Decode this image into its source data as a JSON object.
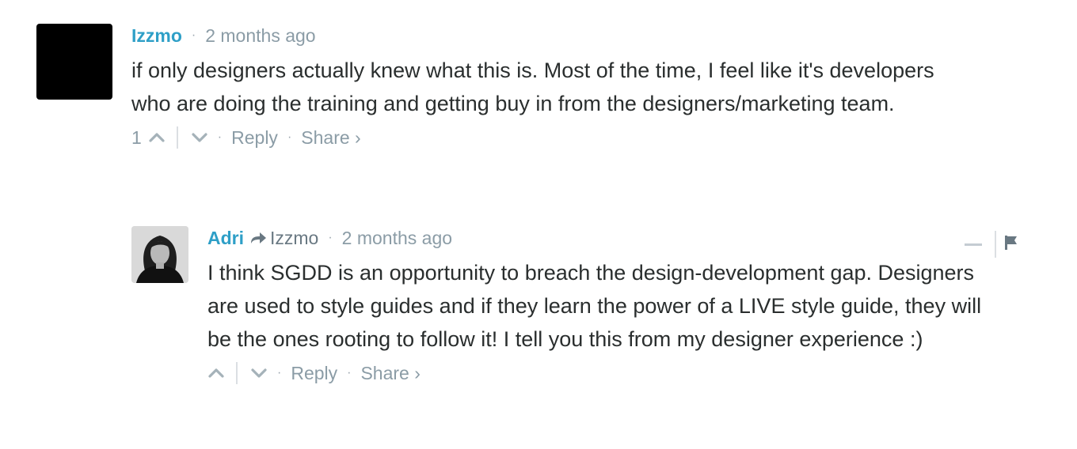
{
  "comments": [
    {
      "author": "Izzmo",
      "separator": "·",
      "time": "2 months ago",
      "text": "if only designers actually knew what this is. Most of the time, I feel like it's developers who are doing the training and getting buy in from the designers/marketing team.",
      "vote_count": "1",
      "reply_label": "Reply",
      "share_label": "Share ›",
      "icons": {
        "upvote": "chevron-up-icon",
        "downvote": "chevron-down-icon"
      }
    },
    {
      "author": "Adri",
      "in_reply_to": "Izzmo",
      "separator": "·",
      "time": "2 months ago",
      "text": "I think SGDD is an opportunity to breach the design-development gap. Designers are used to style guides and if they learn the power of a LIVE style guide, they will be the ones rooting to follow it! I tell you this from my designer experience :)",
      "reply_label": "Reply",
      "share_label": "Share ›",
      "icons": {
        "reply_to": "reply-arrow-icon",
        "upvote": "chevron-up-icon",
        "downvote": "chevron-down-icon",
        "collapse": "minus-icon",
        "flag": "flag-icon"
      }
    }
  ],
  "colors": {
    "author": "#2e9fc7",
    "meta": "#8b9ca6",
    "text": "#2a2e2e"
  }
}
